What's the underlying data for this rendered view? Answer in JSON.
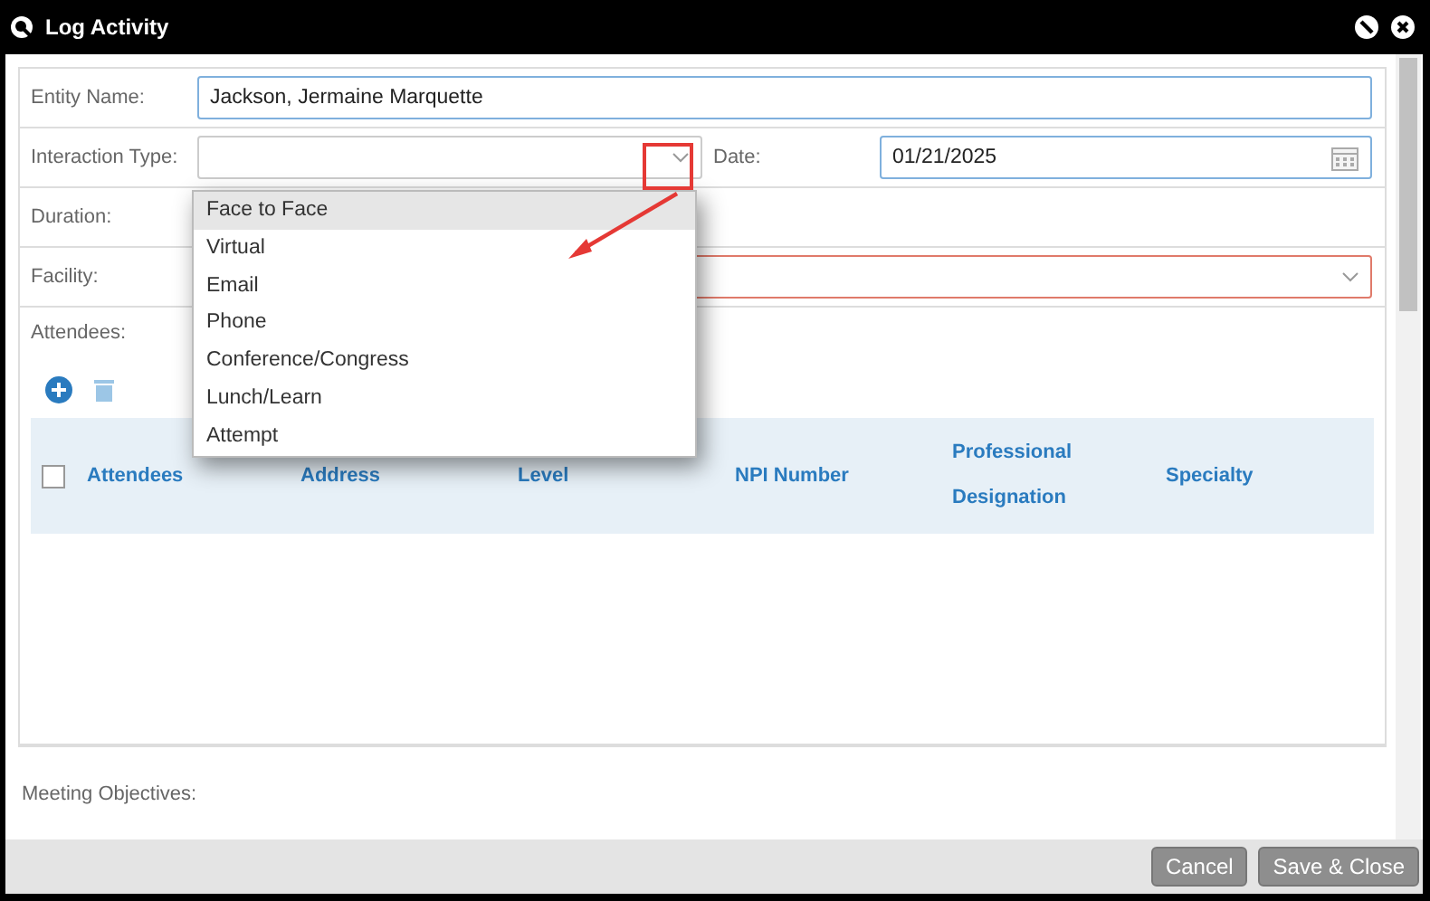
{
  "window": {
    "title": "Log Activity"
  },
  "fields": [
    {
      "kind": "text",
      "label": "Entity Name:",
      "value": "Jackson, Jermaine Marquette"
    },
    {
      "kind": "select-date",
      "label": "Interaction Type:",
      "date_label": "Date:",
      "date_value": "01/21/2025"
    },
    {
      "kind": "empty",
      "label": "Duration:"
    },
    {
      "kind": "select",
      "label": "Facility:",
      "invalid": true
    }
  ],
  "dropdown": {
    "options": [
      {
        "label": "Face to Face",
        "selected": true
      },
      {
        "label": "Virtual",
        "selected": false
      },
      {
        "label": "Email",
        "selected": false
      },
      {
        "label": "Phone",
        "selected": false
      },
      {
        "label": "Conference/Congress",
        "selected": false
      },
      {
        "label": "Lunch/Learn",
        "selected": false
      },
      {
        "label": "Attempt",
        "selected": false
      }
    ]
  },
  "attendees": {
    "label": "Attendees:",
    "select_all": {
      "checked": false
    },
    "columns": [
      "Attendees",
      "Address",
      "Level",
      "NPI Number",
      "Professional Designation",
      "Specialty"
    ]
  },
  "meeting_objectives": {
    "label": "Meeting Objectives:"
  },
  "buttons": [
    {
      "label": "Cancel"
    },
    {
      "label": "Save & Close"
    }
  ]
}
